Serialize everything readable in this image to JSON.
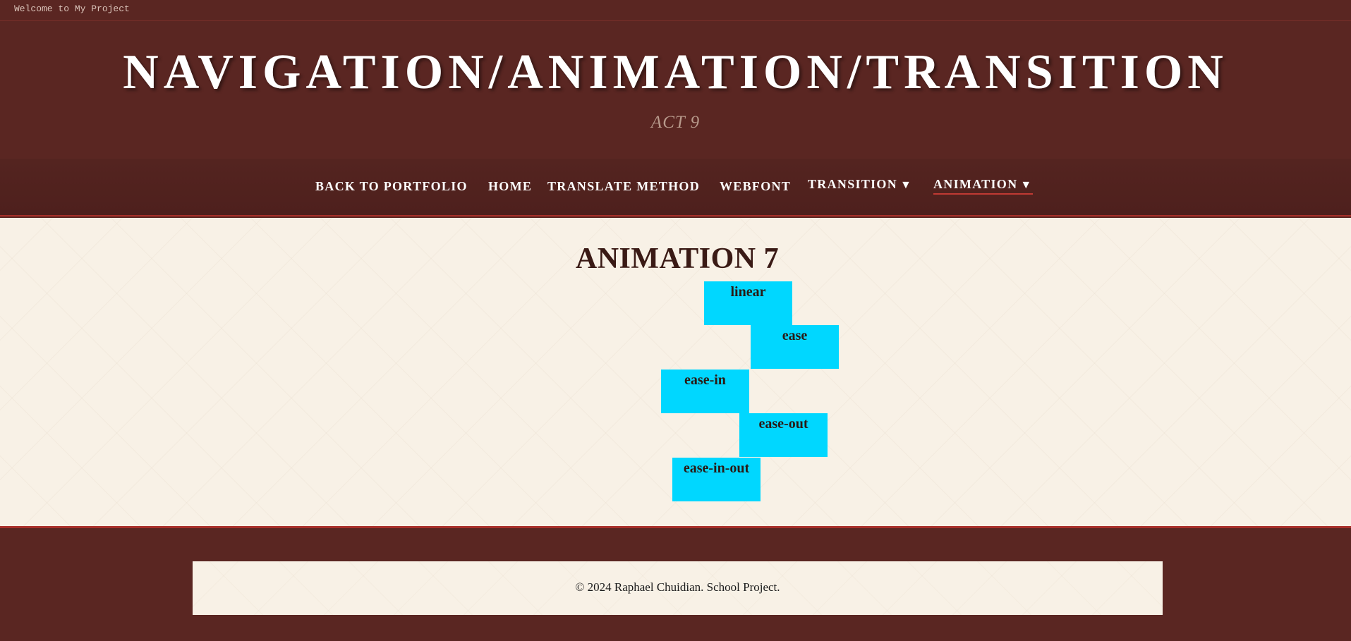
{
  "topbar": {
    "welcome": "Welcome to My Project"
  },
  "header": {
    "title": "NAVIGATION/ANIMATION/TRANSITION",
    "subtitle": "ACT 9"
  },
  "nav": {
    "items": [
      {
        "label": "BACK TO PORTFOLIO"
      },
      {
        "label": "HOME"
      },
      {
        "label": "TRANSLATE METHOD"
      },
      {
        "label": "WEBFONT"
      },
      {
        "label": "TRANSITION",
        "dropdown": "▼"
      },
      {
        "label": "ANIMATION",
        "dropdown": "▼",
        "active": true
      }
    ]
  },
  "main": {
    "title": "ANIMATION 7",
    "boxes": [
      {
        "label": "linear"
      },
      {
        "label": "ease"
      },
      {
        "label": "ease-in"
      },
      {
        "label": "ease-out"
      },
      {
        "label": "ease-in-out"
      }
    ]
  },
  "footer": {
    "text": "© 2024 Raphael Chuidian. School Project."
  },
  "colors": {
    "header_bg": "#5a2622",
    "accent": "#a8302a",
    "content_bg": "#f8f1e6",
    "box": "#00d7ff"
  }
}
